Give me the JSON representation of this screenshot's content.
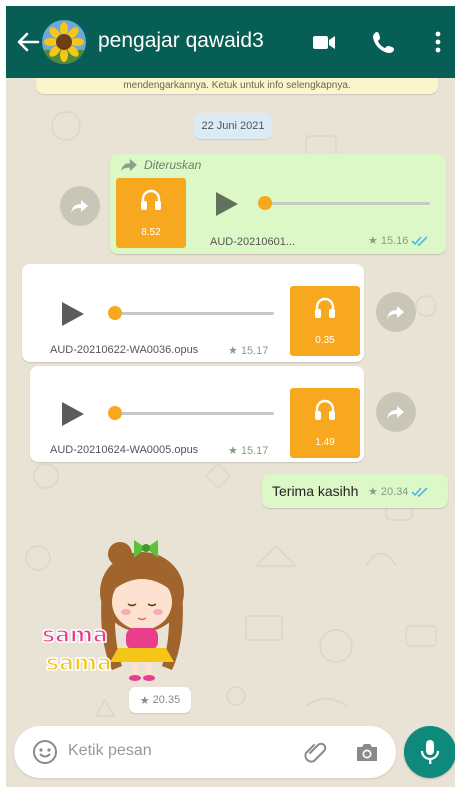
{
  "header": {
    "contact_name": "pengajar qawaid3",
    "icons": [
      "back-arrow-icon",
      "avatar-sunflower",
      "video-call-icon",
      "voice-call-icon",
      "more-options-icon"
    ]
  },
  "notice": {
    "text": "mendengarkannya. Ketuk untuk info selengkapnya."
  },
  "date_chip": "22 Juni 2021",
  "messages": [
    {
      "type": "audio",
      "direction": "outgoing",
      "forwarded_label": "Diteruskan",
      "duration": "8.52",
      "filename": "AUD-20210601...",
      "time": "15.16",
      "starred": true,
      "status": "read"
    },
    {
      "type": "audio",
      "direction": "incoming",
      "duration": "0.35",
      "filename": "AUD-20210622-WA0036.opus",
      "time": "15.17",
      "starred": true
    },
    {
      "type": "audio",
      "direction": "incoming",
      "duration": "1.49",
      "filename": "AUD-20210624-WA0005.opus",
      "time": "15.17",
      "starred": true
    },
    {
      "type": "text",
      "direction": "outgoing",
      "text": "Terima kasihh",
      "time": "20.34",
      "starred": true,
      "status": "read"
    },
    {
      "type": "sticker",
      "direction": "incoming",
      "sticker_text": [
        "sama",
        "sama"
      ],
      "time": "20.35",
      "starred": true
    }
  ],
  "composer": {
    "placeholder": "Ketik pesan",
    "icons": [
      "emoji-icon",
      "attach-icon",
      "camera-icon",
      "mic-icon"
    ]
  },
  "colors": {
    "header": "#075e54",
    "outgoing_bubble": "#dcf8c6",
    "incoming_bubble": "#ffffff",
    "audio_tile": "#f7a81f",
    "read_ticks": "#4fb6ec",
    "mic_button": "#0e8a7c",
    "chat_background": "#e9e3d5"
  }
}
